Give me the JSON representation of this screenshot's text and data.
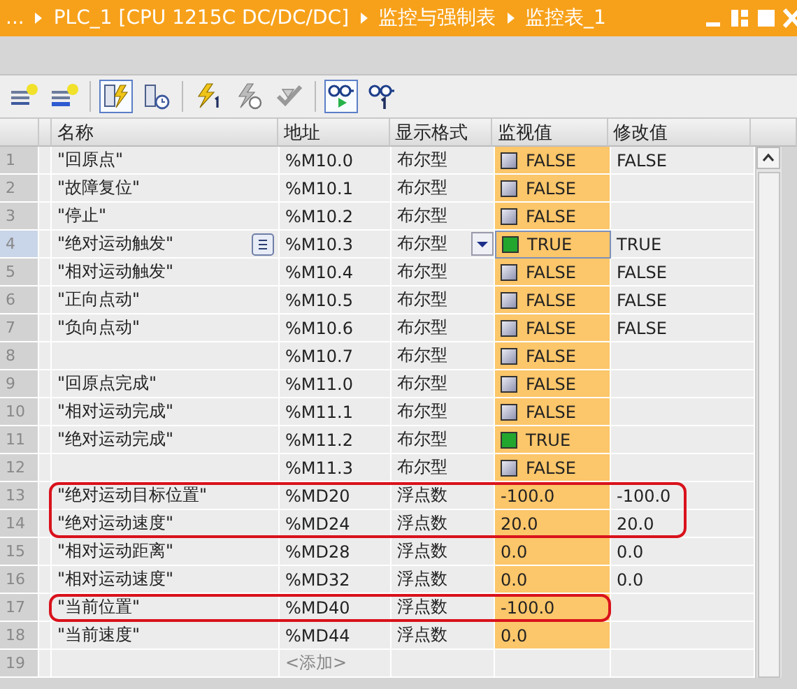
{
  "title_bar": {
    "ellipsis": "...",
    "breadcrumbs": [
      "PLC_1 [CPU 1215C DC/DC/DC]",
      "监控与强制表",
      "监控表_1"
    ]
  },
  "toolbar": [
    {
      "selected": false
    },
    {
      "selected": false
    },
    {
      "selected": true
    },
    {
      "selected": false
    },
    {
      "selected": false
    },
    {
      "selected": false
    },
    {
      "selected": false
    },
    {
      "selected": true
    },
    {
      "selected": false
    }
  ],
  "table": {
    "columns": [
      "名称",
      "地址",
      "显示格式",
      "监视值",
      "修改值"
    ],
    "rows": [
      {
        "number": "1",
        "name": "\"回原点\"",
        "address": "%M10.0",
        "format": "布尔型",
        "kind": "bool",
        "on": false,
        "monitor_value": "FALSE",
        "modify_value": "FALSE",
        "selected": false,
        "outlined": false
      },
      {
        "number": "2",
        "name": "\"故障复位\"",
        "address": "%M10.1",
        "format": "布尔型",
        "kind": "bool",
        "on": false,
        "monitor_value": "FALSE",
        "selected": false,
        "outlined": false
      },
      {
        "number": "3",
        "name": "\"停止\"",
        "address": "%M10.2",
        "format": "布尔型",
        "kind": "bool",
        "on": false,
        "monitor_value": "FALSE",
        "selected": false,
        "outlined": false
      },
      {
        "number": "4",
        "name": "\"绝对运动触发\"",
        "address": "%M10.3",
        "format": "布尔型",
        "kind": "bool",
        "on": true,
        "monitor_value": "TRUE",
        "modify_value": "TRUE",
        "selected": true,
        "outlined": false
      },
      {
        "number": "5",
        "name": "\"相对运动触发\"",
        "address": "%M10.4",
        "format": "布尔型",
        "kind": "bool",
        "on": false,
        "monitor_value": "FALSE",
        "modify_value": "FALSE",
        "selected": false,
        "outlined": false
      },
      {
        "number": "6",
        "name": "\"正向点动\"",
        "address": "%M10.5",
        "format": "布尔型",
        "kind": "bool",
        "on": false,
        "monitor_value": "FALSE",
        "modify_value": "FALSE",
        "selected": false,
        "outlined": false
      },
      {
        "number": "7",
        "name": "\"负向点动\"",
        "address": "%M10.6",
        "format": "布尔型",
        "kind": "bool",
        "on": false,
        "monitor_value": "FALSE",
        "modify_value": "FALSE",
        "selected": false,
        "outlined": false
      },
      {
        "number": "8",
        "address": "%M10.7",
        "format": "布尔型",
        "kind": "bool",
        "on": false,
        "monitor_value": "FALSE",
        "selected": false,
        "outlined": false
      },
      {
        "number": "9",
        "name": "\"回原点完成\"",
        "address": "%M11.0",
        "format": "布尔型",
        "kind": "bool",
        "on": false,
        "monitor_value": "FALSE",
        "selected": false,
        "outlined": false
      },
      {
        "number": "10",
        "name": "\"相对运动完成\"",
        "address": "%M11.1",
        "format": "布尔型",
        "kind": "bool",
        "on": false,
        "monitor_value": "FALSE",
        "selected": false,
        "outlined": false
      },
      {
        "number": "11",
        "name": "\"绝对运动完成\"",
        "address": "%M11.2",
        "format": "布尔型",
        "kind": "bool",
        "on": true,
        "monitor_value": "TRUE",
        "selected": false,
        "outlined": false
      },
      {
        "number": "12",
        "address": "%M11.3",
        "format": "布尔型",
        "kind": "bool",
        "on": false,
        "monitor_value": "FALSE",
        "selected": false,
        "outlined": false
      },
      {
        "number": "13",
        "name": "\"绝对运动目标位置\"",
        "address": "%MD20",
        "format": "浮点数",
        "kind": "float",
        "monitor_value": "-100.0",
        "modify_value": "-100.0",
        "selected": false,
        "outlined": true
      },
      {
        "number": "14",
        "name": "\"绝对运动速度\"",
        "address": "%MD24",
        "format": "浮点数",
        "kind": "float",
        "monitor_value": "20.0",
        "modify_value": "20.0",
        "selected": false,
        "outlined": true
      },
      {
        "number": "15",
        "name": "\"相对运动距离\"",
        "address": "%MD28",
        "format": "浮点数",
        "kind": "float",
        "monitor_value": "0.0",
        "modify_value": "0.0",
        "selected": false,
        "outlined": false
      },
      {
        "number": "16",
        "name": "\"相对运动速度\"",
        "address": "%MD32",
        "format": "浮点数",
        "kind": "float",
        "monitor_value": "0.0",
        "modify_value": "0.0",
        "selected": false,
        "outlined": false
      },
      {
        "number": "17",
        "name": "\"当前位置\"",
        "address": "%MD40",
        "format": "浮点数",
        "kind": "float",
        "monitor_value": "-100.0",
        "selected": false,
        "outlined": true
      },
      {
        "number": "18",
        "name": "\"当前速度\"",
        "address": "%MD44",
        "format": "浮点数",
        "kind": "float",
        "monitor_value": "0.0",
        "selected": false,
        "outlined": false
      },
      {
        "number": "19",
        "address": "<添加>",
        "kind": "add",
        "selected": false,
        "outlined": false
      }
    ]
  }
}
